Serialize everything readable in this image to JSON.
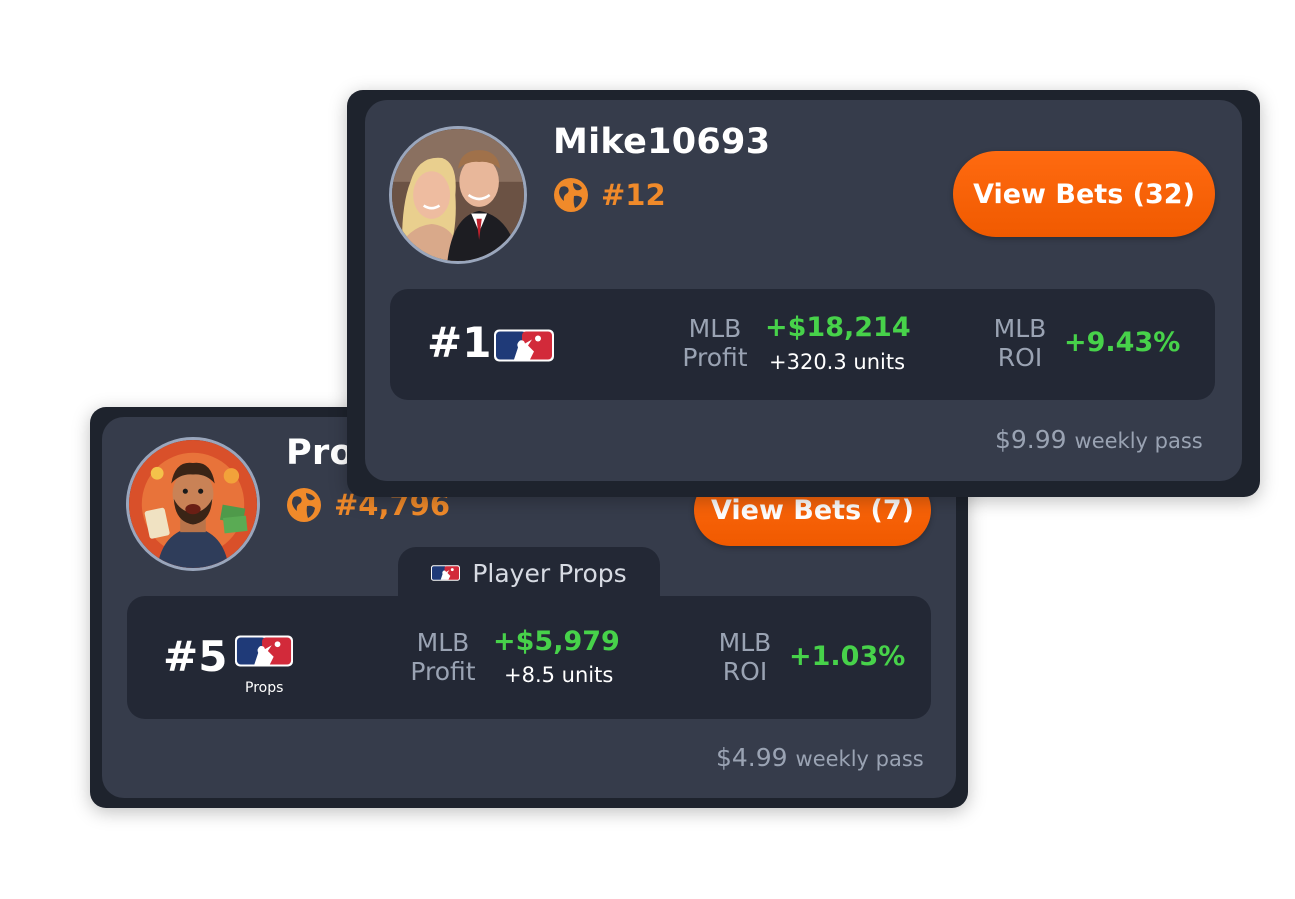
{
  "colors": {
    "accent_orange": "#f05a00",
    "rank_orange": "#f08a2a",
    "profit_green": "#47d24a",
    "card_bg": "#363c4b",
    "stats_bg": "#232835"
  },
  "back_card": {
    "username": "Pro",
    "global_rank": "#4,796",
    "view_bets_label": "View Bets (7)",
    "category_tab": {
      "icon": "mlb-icon",
      "label": "Player Props"
    },
    "league_rank": "#5",
    "league_sub_label": "Props",
    "profit_label_line1": "MLB",
    "profit_label_line2": "Profit",
    "profit_value": "+$5,979",
    "profit_units": "+8.5 units",
    "roi_label_line1": "MLB",
    "roi_label_line2": "ROI",
    "roi_value": "+1.03%",
    "price": "$4.99",
    "price_period": "weekly pass"
  },
  "front_card": {
    "username": "Mike10693",
    "global_rank": "#12",
    "view_bets_label": "View Bets (32)",
    "league_rank": "#1",
    "profit_label_line1": "MLB",
    "profit_label_line2": "Profit",
    "profit_value": "+$18,214",
    "profit_units": "+320.3 units",
    "roi_label_line1": "MLB",
    "roi_label_line2": "ROI",
    "roi_value": "+9.43%",
    "price": "$9.99",
    "price_period": "weekly pass"
  }
}
